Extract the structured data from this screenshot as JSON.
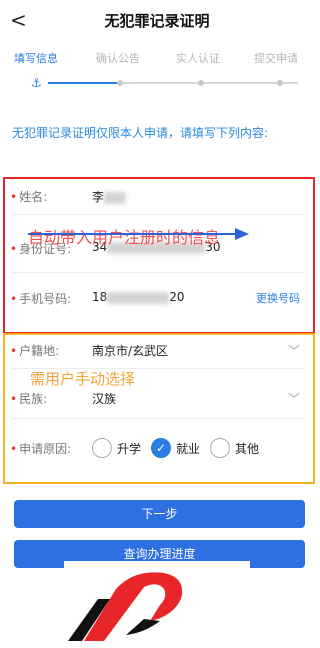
{
  "header": {
    "back_glyph": "<",
    "title": "无犯罪记录证明"
  },
  "steps": [
    {
      "label": "填写信息",
      "active": true
    },
    {
      "label": "确认公告",
      "active": false
    },
    {
      "label": "实人认证",
      "active": false
    },
    {
      "label": "提交申请",
      "active": false
    }
  ],
  "notice": "无犯罪记录证明仅限本人申请，请填写下列内容:",
  "auto_section": {
    "overlay_text": "自动带入用户注册时的信息",
    "name": {
      "label": "姓名:",
      "value_prefix": "李"
    },
    "id": {
      "label": "身份证号:",
      "value_prefix": "34",
      "value_suffix": "30"
    },
    "phone": {
      "label": "手机号码:",
      "value_prefix": "18",
      "value_suffix": "20",
      "action": "更换号码"
    }
  },
  "manual_section": {
    "overlay_text": "需用户手动选择",
    "household": {
      "label": "户籍地:",
      "value": "南京市/玄武区"
    },
    "ethnicity": {
      "label": "民族:",
      "value": "汉族"
    },
    "reason": {
      "label": "申请原因:",
      "options": [
        "升学",
        "就业",
        "其他"
      ],
      "selected": "就业"
    }
  },
  "buttons": {
    "next": "下一步",
    "query": "查询办理进度"
  },
  "colors": {
    "accent": "#2a7de1",
    "red_box": "#e8262a",
    "orange_box": "#f5b324"
  }
}
